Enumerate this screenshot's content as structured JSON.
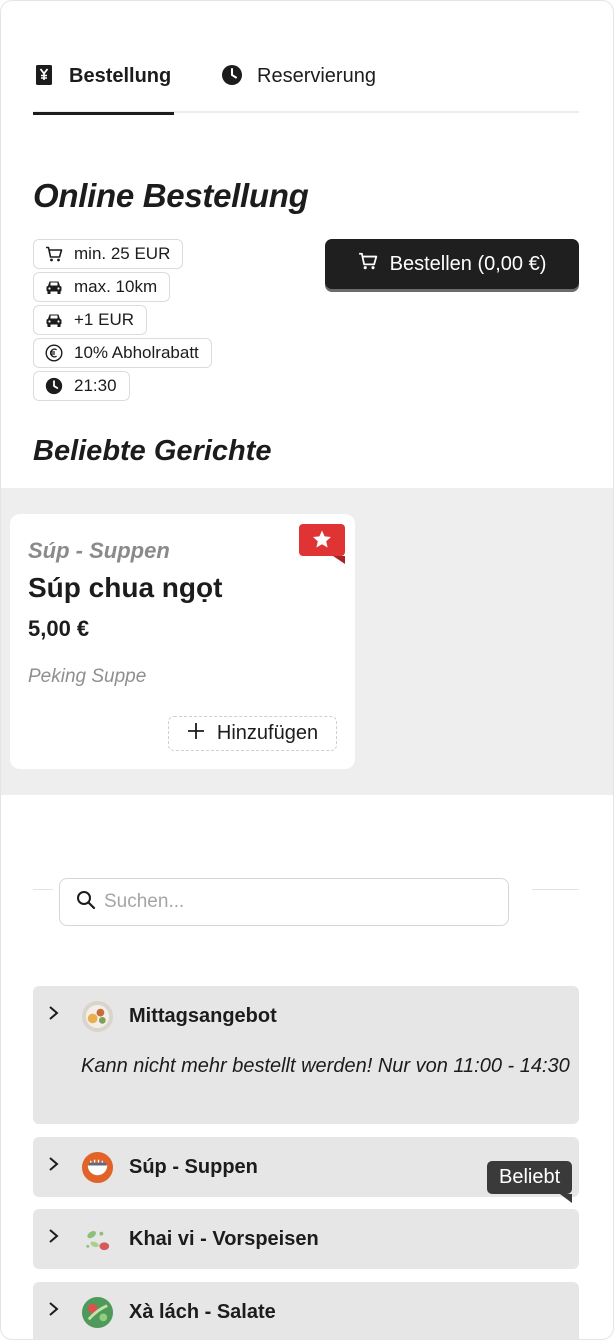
{
  "tabs": {
    "order": {
      "label": "Bestellung",
      "icon": "receipt-yen-icon"
    },
    "reservation": {
      "label": "Reservierung",
      "icon": "clock-icon"
    }
  },
  "online": {
    "title": "Online Bestellung",
    "badges": [
      {
        "icon": "cart-icon",
        "label": "min. 25 EUR"
      },
      {
        "icon": "car-icon",
        "label": "max. 10km"
      },
      {
        "icon": "car-icon",
        "label": "+1 EUR"
      },
      {
        "icon": "euro-icon",
        "label": "10% Abholrabatt"
      },
      {
        "icon": "clock-icon",
        "label": "21:30"
      }
    ],
    "order_button": "Bestellen (0,00 €)"
  },
  "popular": {
    "title": "Beliebte Gerichte",
    "card": {
      "category": "Súp - Suppen",
      "name": "Súp chua ngọt",
      "price": "5,00 €",
      "description": "Peking Suppe",
      "add_label": "Hinzufügen"
    }
  },
  "search": {
    "placeholder": "Suchen..."
  },
  "categories": [
    {
      "name": "Mittagsangebot",
      "note": "Kann nicht mehr bestellt werden! Nur von 11:00 - 14:30",
      "icon": "lunch-plate-icon"
    },
    {
      "name": "Súp - Suppen",
      "icon": "soup-bowl-icon"
    },
    {
      "name": "Khai vi - Vorspeisen",
      "icon": "starter-icon"
    },
    {
      "name": "Xà lách - Salate",
      "icon": "salad-icon"
    }
  ],
  "tooltip": "Beliebt",
  "colors": {
    "accent": "#1f1f1f",
    "flag": "#e03434",
    "band": "#eeeeee",
    "category_bg": "#e6e6e6"
  }
}
